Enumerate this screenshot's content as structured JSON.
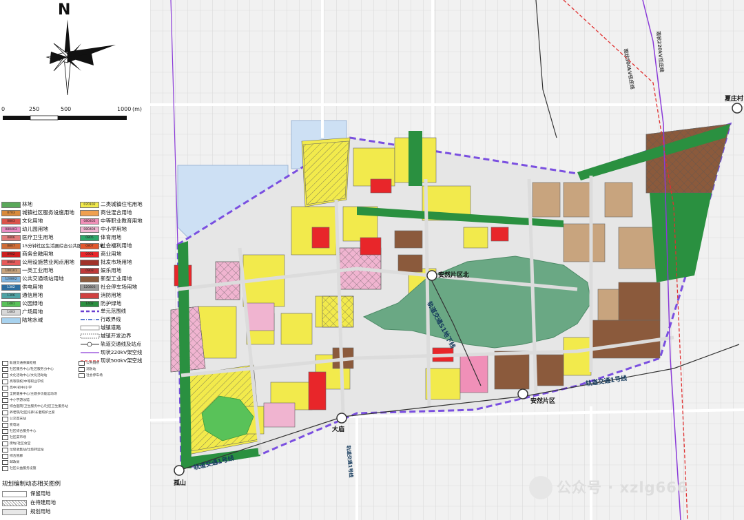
{
  "compass": {
    "north": "N"
  },
  "scale": {
    "ticks": [
      "0",
      "250",
      "500",
      "1000"
    ],
    "unit": "(m)"
  },
  "legend_landuse": [
    {
      "label": "林地",
      "code": "",
      "color": "#5aa85a"
    },
    {
      "label": "城镇社区服务设施用地",
      "code": "0703",
      "color": "#d98a3a"
    },
    {
      "label": "文化用地",
      "code": "0803",
      "color": "#d9534a"
    },
    {
      "label": "幼儿园用地",
      "code": "080403",
      "color": "#e88cc3"
    },
    {
      "label": "医疗卫生用地",
      "code": "0806",
      "color": "#e07a7a"
    },
    {
      "label": "15分钟社区生活圈综合公共服务设施用地",
      "code": "0807",
      "color": "#cf6c36"
    },
    {
      "label": "商务金融用地",
      "code": "0902",
      "color": "#cc1f1f"
    },
    {
      "label": "公用设施营业网点用地",
      "code": "0904",
      "color": "#e65a5a"
    },
    {
      "label": "一类工业用地",
      "code": "100101",
      "color": "#c8a47e"
    },
    {
      "label": "公共交通场站用地",
      "code": "120802",
      "color": "#7fb4e0"
    },
    {
      "label": "供电用地",
      "code": "1302",
      "color": "#2e6d9e"
    },
    {
      "label": "通信用地",
      "code": "1306",
      "color": "#4fa3a5"
    },
    {
      "label": "公园绿地",
      "code": "1401",
      "color": "#59c259"
    },
    {
      "label": "广场用地",
      "code": "1403",
      "color": "#d8d8d8"
    },
    {
      "label": "陆地水域",
      "code": "",
      "color": "#a8d2ee"
    },
    {
      "label": "二类城镇住宅用地",
      "code": "070102",
      "color": "#f2ea4c"
    },
    {
      "label": "商住混合用地",
      "code": "",
      "color": "#f0a050"
    },
    {
      "label": "中等职业教育用地",
      "code": "080402",
      "color": "#f090b8"
    },
    {
      "label": "中小学用地",
      "code": "080404",
      "color": "#f0b4d0"
    },
    {
      "label": "体育用地",
      "code": "0805",
      "color": "#2ea66a"
    },
    {
      "label": "社会福利用地",
      "code": "0807",
      "color": "#e2572e"
    },
    {
      "label": "商业用地",
      "code": "0901",
      "color": "#e8262a"
    },
    {
      "label": "批发市场用地",
      "code": "",
      "color": "#a0322a"
    },
    {
      "label": "娱乐用地",
      "code": "0903",
      "color": "#bf3a3a"
    },
    {
      "label": "新型工业用地",
      "code": "",
      "color": "#8b5a3c"
    },
    {
      "label": "社会停车场用地",
      "code": "120803",
      "color": "#9a9a9a"
    },
    {
      "label": "消防用地",
      "code": "",
      "color": "#d04040"
    },
    {
      "label": "防护绿地",
      "code": "1402",
      "color": "#2a9040"
    }
  ],
  "legend_lines": [
    {
      "label": "单元范围线",
      "color": "#6a3fd0",
      "style": "dash"
    },
    {
      "label": "行政界线",
      "color": "#2450c0",
      "style": "dashdot"
    },
    {
      "label": "城镇道路",
      "color": "#888888",
      "style": "road"
    },
    {
      "label": "城镇开发边界",
      "color": "#555555",
      "style": "outline"
    },
    {
      "label": "轨道交通线及站点",
      "color": "#333333",
      "style": "rail"
    },
    {
      "label": "现状220kV架空线",
      "color": "#8a3ad8",
      "style": "solid"
    },
    {
      "label": "现状500kV架空线",
      "color": "#e03030",
      "style": "dash"
    }
  ],
  "legend_facilities": [
    "轨道交通换乘枢纽",
    "社区服务中心/社区服务分中心",
    "文化活动中心/文化活动站",
    "高等院校/中等职业学校",
    "高中/初中/小学",
    "全民健身中心/主题多功能运动场",
    "中小学游泳馆",
    "综合医院/卫生服务中心/社区卫生服务站",
    "养老院/社区托养/长者照护之家",
    "公交首末站",
    "变电站",
    "社区综合服务中心",
    "社区菜市场",
    "街坊/社区食堂",
    "垃圾收集站/垃圾转运站",
    "综合管廊",
    "邮政局",
    "社区公益服务设施",
    "公共厕所",
    "消防站",
    "社会停车场"
  ],
  "planning_legend": {
    "title": "规划编制动态相关图例",
    "items": [
      {
        "label": "保留用地",
        "fill": "#ffffff",
        "pattern": "none"
      },
      {
        "label": "在待建用地",
        "fill": "#ffffff",
        "pattern": "hatch"
      },
      {
        "label": "规划用地",
        "fill": "#ffffff",
        "pattern": "solid"
      }
    ]
  },
  "map_labels": {
    "stations": [
      "夏庄村",
      "安然片区北",
      "安然片区",
      "大庙",
      "孤山"
    ],
    "rail_lines": [
      "轨道交通1号线",
      "轨道交通S1地下线",
      "轨道交通1号线"
    ],
    "power_lines": [
      "现状500kV任庄线",
      "现状220kV任庄线"
    ],
    "roads": [
      "轨道交通1号线"
    ]
  },
  "watermark": "公众号 · xzlg666"
}
